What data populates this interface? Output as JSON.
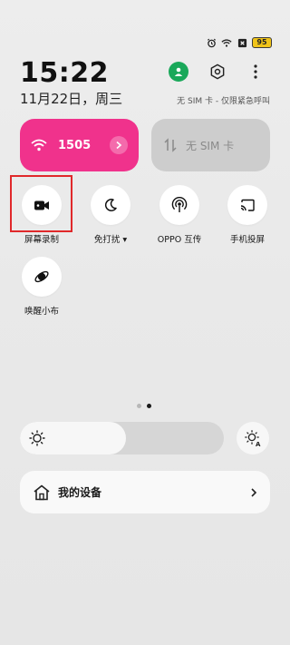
{
  "status_bar": {
    "icons": [
      "alarm-icon",
      "wifi-icon",
      "no-sim-icon",
      "battery-icon"
    ],
    "battery": "95"
  },
  "header": {
    "time": "15:22",
    "date": "11月22日，周三",
    "sim_status": "无 SIM 卡 - 仅限紧急呼叫"
  },
  "network": {
    "wifi_label": "1505",
    "sim_label": "无 SIM 卡"
  },
  "toggles": [
    {
      "label": "屏幕录制",
      "icon": "video-camera-icon"
    },
    {
      "label": "免打扰 ▾",
      "icon": "moon-icon"
    },
    {
      "label": "OPPO 互传",
      "icon": "share-signal-icon"
    },
    {
      "label": "手机投屏",
      "icon": "cast-icon"
    },
    {
      "label": "唤醒小布",
      "icon": "breeno-icon"
    }
  ],
  "pager": {
    "pages": 2,
    "current": 2
  },
  "brightness": {
    "level": 0.5,
    "auto_icon": "auto-brightness-icon"
  },
  "devices": {
    "label": "我的设备"
  },
  "colors": {
    "wifi_tile": "#f0328c",
    "sim_tile": "#cdcdcd",
    "avatar": "#1aa85a",
    "battery": "#f0c419",
    "highlight": "#e0282a"
  }
}
